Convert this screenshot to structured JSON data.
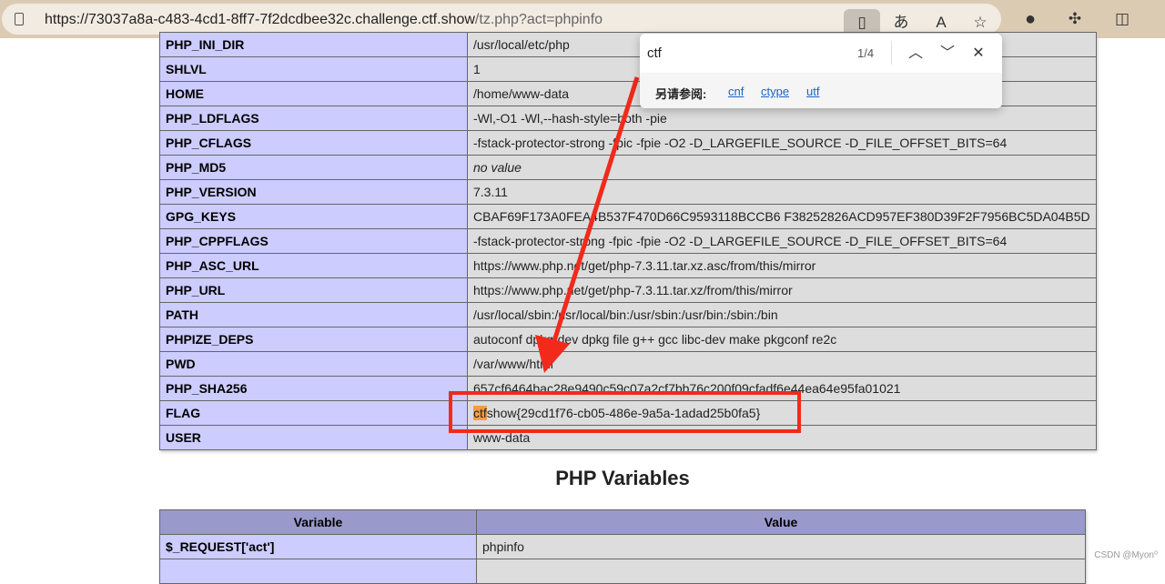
{
  "browser": {
    "url_main": "https://73037a8a-c483-4cd1-8ff7-7f2dcdbee32c.challenge.ctf.show",
    "url_path": "/tz.php?act=phpinfo",
    "icons": [
      "lock-icon",
      "reader-icon",
      "translate-icon",
      "read-aloud-icon",
      "favorite-icon",
      "circle-extension-icon",
      "extensions-icon",
      "split-screen-icon"
    ]
  },
  "env_rows": [
    {
      "name": "PHP_INI_DIR",
      "value": "/usr/local/etc/php"
    },
    {
      "name": "SHLVL",
      "value": "1"
    },
    {
      "name": "HOME",
      "value": "/home/www-data"
    },
    {
      "name": "PHP_LDFLAGS",
      "value": "-Wl,-O1 -Wl,--hash-style=both -pie"
    },
    {
      "name": "PHP_CFLAGS",
      "value": "-fstack-protector-strong -fpic -fpie -O2 -D_LARGEFILE_SOURCE -D_FILE_OFFSET_BITS=64"
    },
    {
      "name": "PHP_MD5",
      "value": "no value"
    },
    {
      "name": "PHP_VERSION",
      "value": "7.3.11"
    },
    {
      "name": "GPG_KEYS",
      "value": "CBAF69F173A0FEA4B537F470D66C9593118BCCB6 F38252826ACD957EF380D39F2F7956BC5DA04B5D"
    },
    {
      "name": "PHP_CPPFLAGS",
      "value": "-fstack-protector-strong -fpic -fpie -O2 -D_LARGEFILE_SOURCE -D_FILE_OFFSET_BITS=64"
    },
    {
      "name": "PHP_ASC_URL",
      "value": "https://www.php.net/get/php-7.3.11.tar.xz.asc/from/this/mirror"
    },
    {
      "name": "PHP_URL",
      "value": "https://www.php.net/get/php-7.3.11.tar.xz/from/this/mirror"
    },
    {
      "name": "PATH",
      "value": "/usr/local/sbin:/usr/local/bin:/usr/sbin:/usr/bin:/sbin:/bin"
    },
    {
      "name": "PHPIZE_DEPS",
      "value": "autoconf dpkg-dev dpkg file g++ gcc libc-dev make pkgconf re2c"
    },
    {
      "name": "PWD",
      "value": "/var/www/html"
    },
    {
      "name": "PHP_SHA256",
      "value": "657cf6464bac28e9490c59c07a2cf7bb76c200f09cfadf6e44ea64e95fa01021"
    },
    {
      "name": "FLAG",
      "value_highlight": "ctf",
      "value_rest": "show{29cd1f76-cb05-486e-9a5a-1adad25b0fa5}"
    },
    {
      "name": "USER",
      "value": "www-data"
    }
  ],
  "variables": {
    "title": "PHP Variables",
    "headers": [
      "Variable",
      "Value"
    ],
    "rows": [
      {
        "name": "$_REQUEST['act']",
        "value": "phpinfo"
      }
    ]
  },
  "find": {
    "query": "ctf",
    "count": "1/4",
    "see_also_label": "另请参阅:",
    "suggestions": [
      "cnf",
      "ctype",
      "utf"
    ]
  },
  "watermark": "CSDN @Myon⁰",
  "colors": {
    "highlight": "#f39c43",
    "annotation": "#f12a1b"
  }
}
